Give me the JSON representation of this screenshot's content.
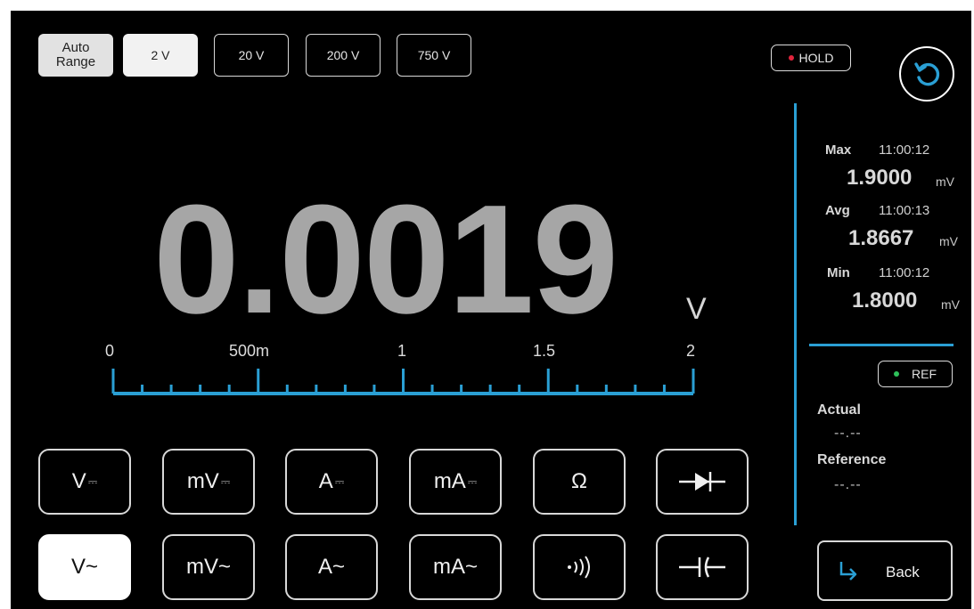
{
  "range_buttons": {
    "auto_line1": "Auto",
    "auto_line2": "Range",
    "r2": "2 V",
    "r20": "20 V",
    "r200": "200 V",
    "r750": "750 V",
    "selected": "2 V"
  },
  "hold": {
    "label": "HOLD",
    "indicator_color": "#e0243c"
  },
  "reading": {
    "value": "0.0019",
    "unit": "V"
  },
  "scale": {
    "labels": [
      "0",
      "500m",
      "1",
      "1.5",
      "2"
    ],
    "color": "#2a9fd4"
  },
  "stats": {
    "max": {
      "label": "Max",
      "time": "11:00:12",
      "value": "1.9000",
      "unit": "mV"
    },
    "avg": {
      "label": "Avg",
      "time": "11:00:13",
      "value": "1.8667",
      "unit": "mV"
    },
    "min": {
      "label": "Min",
      "time": "11:00:12",
      "value": "1.8000",
      "unit": "mV"
    }
  },
  "ref": {
    "label": "REF",
    "indicator_color": "#2ec05a"
  },
  "actual": {
    "label": "Actual",
    "value": "--.--"
  },
  "reference": {
    "label": "Reference",
    "value": "--.--"
  },
  "back": {
    "label": "Back"
  },
  "functions": {
    "v_dc": "V",
    "mv_dc": "mV",
    "a_dc": "A",
    "ma_dc": "mA",
    "ohm": "Ω",
    "v_ac": "V~",
    "mv_ac": "mV~",
    "a_ac": "A~",
    "ma_ac": "mA~",
    "dc_symbol": "⎓",
    "active": "V~"
  },
  "accent_color": "#2a9fd4"
}
